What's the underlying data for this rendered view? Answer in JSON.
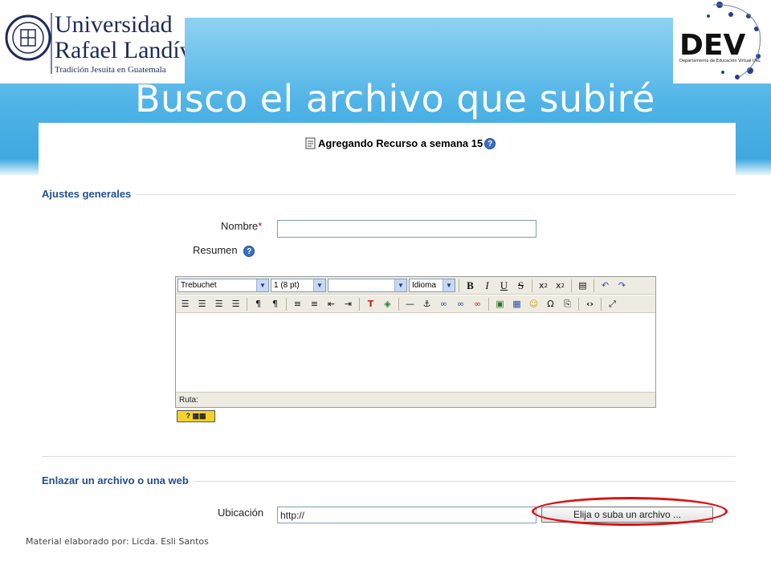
{
  "slide": {
    "title": "Busco el archivo que subiré",
    "footer": "Material elaborado por: Licda. Esli Santos",
    "logo_left": {
      "line1": "Universidad",
      "line2": "Rafael Landívar",
      "tagline": "Tradición Jesuita en Guatemala"
    },
    "logo_right": {
      "text": "DEV",
      "subtext": "Departamento de Educación Virtual URL"
    },
    "colors": {
      "banner": "#4fb3e6",
      "title": "#ffffff",
      "legend": "#214f92",
      "required": "#aa1122",
      "highlight": "#e01010"
    }
  },
  "form": {
    "heading": "Agregando Recurso a semana 15",
    "general": {
      "legend": "Ajustes generales",
      "name_label": "Nombre",
      "required_mark": "*",
      "name_value": "",
      "summary_label": "Resumen"
    },
    "editor": {
      "font_family": "Trebuchet",
      "font_size": "1 (8 pt)",
      "format": "",
      "language": "Idioma",
      "path_label": "Ruta:",
      "icons": [
        "bold-icon",
        "italic-icon",
        "underline-icon",
        "strikethrough-icon",
        "subscript-icon",
        "superscript-icon",
        "clean-word-icon",
        "undo-icon",
        "redo-icon",
        "align-left-icon",
        "align-center-icon",
        "align-right-icon",
        "align-justify-icon",
        "ltr-icon",
        "rtl-icon",
        "ordered-list-icon",
        "unordered-list-icon",
        "outdent-icon",
        "indent-icon",
        "text-color-icon",
        "background-color-icon",
        "horizontal-rule-icon",
        "anchor-icon",
        "link-icon",
        "unlink-icon",
        "nolink-icon",
        "image-icon",
        "table-icon",
        "smiley-icon",
        "special-char-icon",
        "search-replace-icon",
        "html-source-icon",
        "fullscreen-icon"
      ]
    },
    "link": {
      "legend": "Enlazar un archivo o una web",
      "location_label": "Ubicación",
      "location_value": "http://",
      "choose_button": "Elija o suba un archivo ..."
    }
  }
}
